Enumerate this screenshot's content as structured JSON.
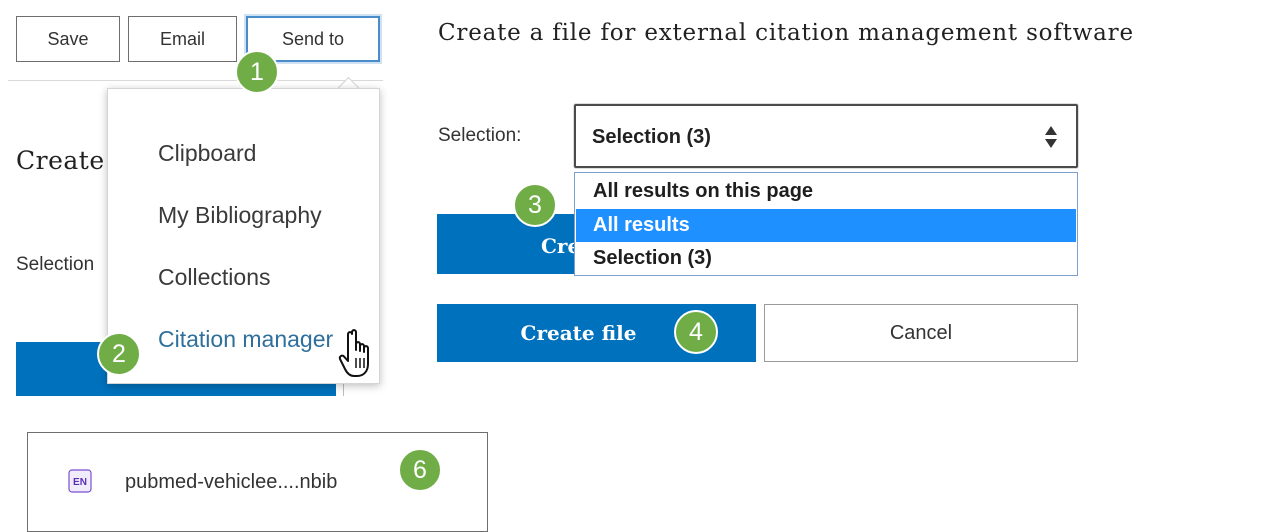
{
  "toolbar": {
    "save_label": "Save",
    "email_label": "Email",
    "send_to_label": "Send to"
  },
  "send_to_menu": {
    "items": [
      {
        "label": "Clipboard"
      },
      {
        "label": "My Bibliography"
      },
      {
        "label": "Collections"
      },
      {
        "label": "Citation manager"
      }
    ]
  },
  "background_panel": {
    "heading_partial": "Create",
    "selection_label_partial": "Selection"
  },
  "citation_panel": {
    "title": "Create a file for external citation management software",
    "selection_label": "Selection:",
    "selected_value": "Selection (3)",
    "options": [
      {
        "label": "All results on this page",
        "highlighted": false
      },
      {
        "label": "All results",
        "highlighted": true
      },
      {
        "label": "Selection (3)",
        "highlighted": false
      }
    ],
    "obscured_button_partial": "Cre",
    "create_file_label": "Create file",
    "cancel_label": "Cancel"
  },
  "download": {
    "icon_text": "EN",
    "file_name": "pubmed-vehiclee....nbib"
  },
  "steps": {
    "step1": "1",
    "step2": "2",
    "step3": "3",
    "step4": "4",
    "step6": "6"
  },
  "colors": {
    "primary_blue": "#0071bc",
    "option_highlight": "#1e90ff",
    "badge_green": "#70ad47",
    "link_text": "#2e6f9c"
  }
}
